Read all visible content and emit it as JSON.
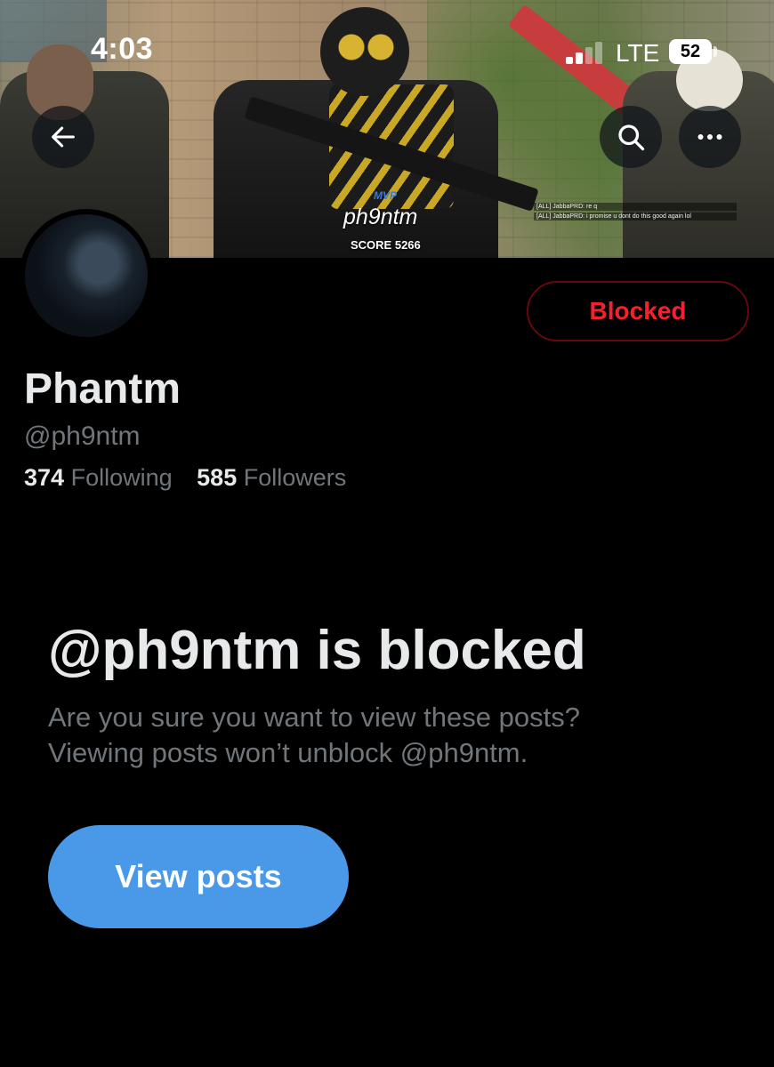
{
  "status_bar": {
    "time": "4:03",
    "network": "LTE",
    "battery": "52"
  },
  "banner": {
    "mvp_label": "MVP",
    "mvp_name": "ph9ntm",
    "score": "SCORE 5266",
    "chat_lines": [
      "[ALL] JabbaPRD: re q",
      "[ALL] JabbaPRD: i promise u dont do this good again lol"
    ]
  },
  "header": {
    "back_icon": "arrow-left-icon",
    "search_icon": "search-icon",
    "more_icon": "more-horizontal-icon"
  },
  "profile": {
    "name": "Phantm",
    "handle": "@ph9ntm",
    "following_count": "374",
    "following_label": "Following",
    "followers_count": "585",
    "followers_label": "Followers",
    "blocked_button": "Blocked"
  },
  "blocked_notice": {
    "title": "@ph9ntm is blocked",
    "line1": "Are you sure you want to view these posts?",
    "line2": "Viewing posts won’t unblock @ph9ntm.",
    "view_button": "View posts"
  },
  "colors": {
    "background": "#000000",
    "blocked_red": "#f4212e",
    "accent_blue": "#4a99e9",
    "secondary_text": "#71767b"
  }
}
